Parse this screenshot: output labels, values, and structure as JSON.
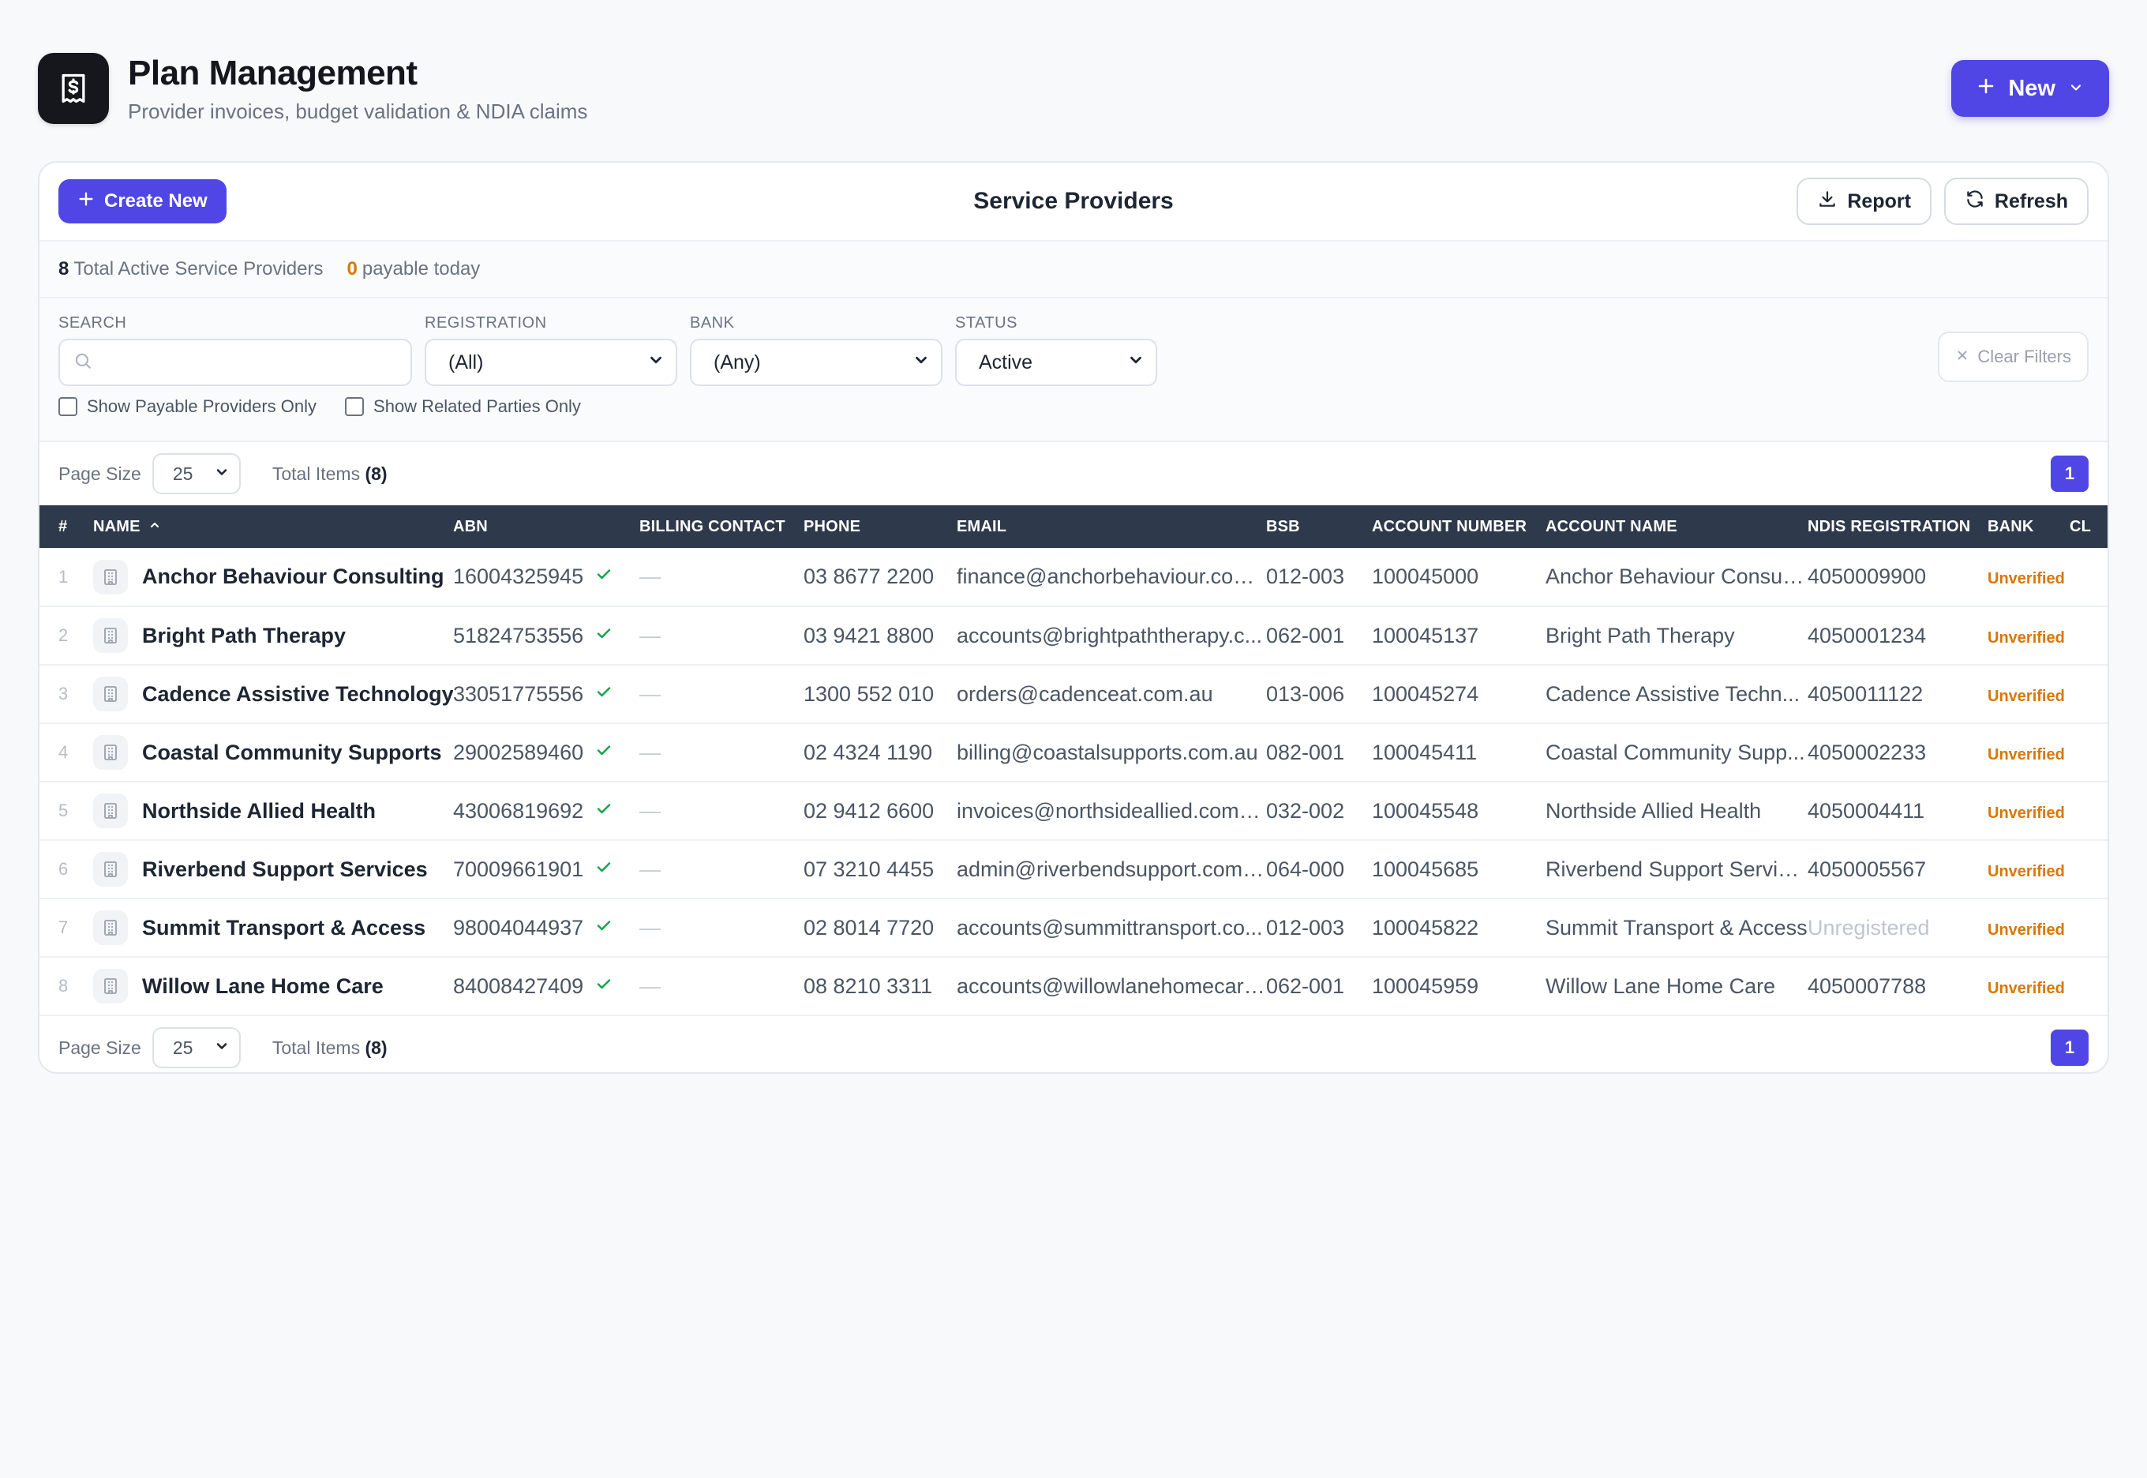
{
  "app": {
    "title": "Plan Management",
    "subtitle": "Provider invoices, budget validation & NDIA claims",
    "new_label": "New"
  },
  "card": {
    "create_label": "Create New",
    "title": "Service Providers",
    "report_label": "Report",
    "refresh_label": "Refresh"
  },
  "summary": {
    "active_count": "8",
    "active_label": "Total Active Service Providers",
    "payable_count": "0",
    "payable_label": "payable today"
  },
  "filters": {
    "search_label": "SEARCH",
    "search_value": "",
    "registration_label": "REGISTRATION",
    "registration_value": "(All)",
    "bank_label": "BANK",
    "bank_value": "(Any)",
    "status_label": "STATUS",
    "status_value": "Active",
    "clear_label": "Clear Filters",
    "payable_only_label": "Show Payable Providers Only",
    "related_only_label": "Show Related Parties Only"
  },
  "pager": {
    "page_size_label": "Page Size",
    "page_size": "25",
    "total_label": "Total Items",
    "total_value": "(8)",
    "current_page": "1"
  },
  "table": {
    "columns": [
      "#",
      "NAME",
      "ABN",
      "BILLING CONTACT",
      "PHONE",
      "EMAIL",
      "BSB",
      "ACCOUNT NUMBER",
      "ACCOUNT NAME",
      "NDIS REGISTRATION",
      "BANK",
      "CL"
    ],
    "rows": [
      {
        "index": "1",
        "name": "Anchor Behaviour Consulting",
        "abn": "16004325945",
        "billing": "—",
        "phone": "03 8677 2200",
        "email": "finance@anchorbehaviour.com....",
        "bsb": "012-003",
        "account_number": "100045000",
        "account_name": "Anchor Behaviour Consult...",
        "ndis": "4050009900",
        "bank": "Unverified"
      },
      {
        "index": "2",
        "name": "Bright Path Therapy",
        "abn": "51824753556",
        "billing": "—",
        "phone": "03 9421 8800",
        "email": "accounts@brightpaththerapy.c...",
        "bsb": "062-001",
        "account_number": "100045137",
        "account_name": "Bright Path Therapy",
        "ndis": "4050001234",
        "bank": "Unverified"
      },
      {
        "index": "3",
        "name": "Cadence Assistive Technology",
        "abn": "33051775556",
        "billing": "—",
        "phone": "1300 552 010",
        "email": "orders@cadenceat.com.au",
        "bsb": "013-006",
        "account_number": "100045274",
        "account_name": "Cadence Assistive Techn...",
        "ndis": "4050011122",
        "bank": "Unverified"
      },
      {
        "index": "4",
        "name": "Coastal Community Supports",
        "abn": "29002589460",
        "billing": "—",
        "phone": "02 4324 1190",
        "email": "billing@coastalsupports.com.au",
        "bsb": "082-001",
        "account_number": "100045411",
        "account_name": "Coastal Community Supp...",
        "ndis": "4050002233",
        "bank": "Unverified"
      },
      {
        "index": "5",
        "name": "Northside Allied Health",
        "abn": "43006819692",
        "billing": "—",
        "phone": "02 9412 6600",
        "email": "invoices@northsideallied.com.au",
        "bsb": "032-002",
        "account_number": "100045548",
        "account_name": "Northside Allied Health",
        "ndis": "4050004411",
        "bank": "Unverified"
      },
      {
        "index": "6",
        "name": "Riverbend Support Services",
        "abn": "70009661901",
        "billing": "—",
        "phone": "07 3210 4455",
        "email": "admin@riverbendsupport.com.au",
        "bsb": "064-000",
        "account_number": "100045685",
        "account_name": "Riverbend Support Services",
        "ndis": "4050005567",
        "bank": "Unverified"
      },
      {
        "index": "7",
        "name": "Summit Transport & Access",
        "abn": "98004044937",
        "billing": "—",
        "phone": "02 8014 7720",
        "email": "accounts@summittransport.co...",
        "bsb": "012-003",
        "account_number": "100045822",
        "account_name": "Summit Transport & Access",
        "ndis": "Unregistered",
        "bank": "Unverified"
      },
      {
        "index": "8",
        "name": "Willow Lane Home Care",
        "abn": "84008427409",
        "billing": "—",
        "phone": "08 8210 3311",
        "email": "accounts@willowlanehomecare...",
        "bsb": "062-001",
        "account_number": "100045959",
        "account_name": "Willow Lane Home Care",
        "ndis": "4050007788",
        "bank": "Unverified"
      }
    ]
  },
  "colors": {
    "accent": "#4f46e5",
    "header_bg": "#2e3a4c",
    "warning": "#d97706",
    "success": "#16a34a"
  },
  "icons": {
    "logo": "invoice-dollar-icon",
    "new": "plus-icon",
    "report": "download-icon",
    "refresh": "refresh-icon",
    "search": "search-icon",
    "clear": "close-icon",
    "row": "building-icon",
    "verified": "check-icon",
    "sort": "sort-asc-icon"
  }
}
